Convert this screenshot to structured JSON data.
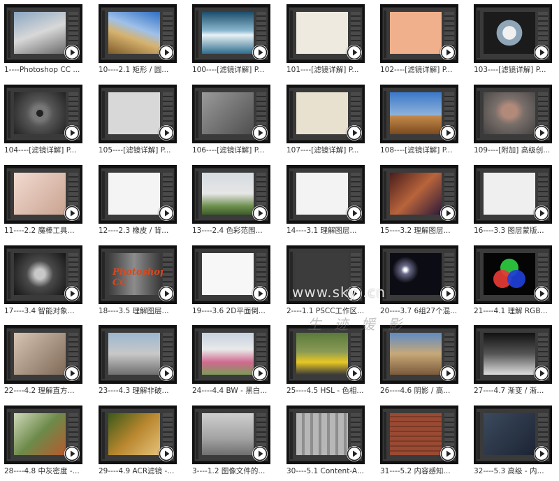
{
  "videos": [
    {
      "caption": "1----Photoshop CC ...",
      "visual": "v0"
    },
    {
      "caption": "10----2.1 矩形 / 圆...",
      "visual": "v1"
    },
    {
      "caption": "100----[滤镜详解] P...",
      "visual": "v2"
    },
    {
      "caption": "101----[滤镜详解] P...",
      "visual": "v3"
    },
    {
      "caption": "102----[滤镜详解] P...",
      "visual": "v4"
    },
    {
      "caption": "103----[滤镜详解] P...",
      "visual": "v5"
    },
    {
      "caption": "104----[滤镜详解] P...",
      "visual": "v6"
    },
    {
      "caption": "105----[滤镜详解] P...",
      "visual": "v7"
    },
    {
      "caption": "106----[滤镜详解] P...",
      "visual": "v8"
    },
    {
      "caption": "107----[滤镜详解] P...",
      "visual": "v9"
    },
    {
      "caption": "108----[滤镜详解] P...",
      "visual": "v10"
    },
    {
      "caption": "109----[附加] 高级创...",
      "visual": "v11"
    },
    {
      "caption": "11----2.2 魔棒工具...",
      "visual": "v12"
    },
    {
      "caption": "12----2.3 橡皮 / 背...",
      "visual": "v13"
    },
    {
      "caption": "13----2.4 色彩范围...",
      "visual": "v14"
    },
    {
      "caption": "14----3.1 理解图层...",
      "visual": "v15"
    },
    {
      "caption": "15----3.2 理解图层...",
      "visual": "v16"
    },
    {
      "caption": "16----3.3 图层蒙版...",
      "visual": "v17"
    },
    {
      "caption": "17----3.4 智能对象...",
      "visual": "v18"
    },
    {
      "caption": "18----3.5 理解图层...",
      "visual": "v19",
      "logo": "Photoshop CC"
    },
    {
      "caption": "19----3.6 2D平面倒...",
      "visual": "v20"
    },
    {
      "caption": "2----1.1 PSCC工作区...",
      "visual": "v21"
    },
    {
      "caption": "20----3.7 6组27个混...",
      "visual": "v22"
    },
    {
      "caption": "21----4.1 理解 RGB...",
      "visual": "v23"
    },
    {
      "caption": "22----4.2 理解直方...",
      "visual": "v24"
    },
    {
      "caption": "23----4.3 理解非破...",
      "visual": "v25"
    },
    {
      "caption": "24----4.4 BW - 黑白...",
      "visual": "v26"
    },
    {
      "caption": "25----4.5 HSL - 色相...",
      "visual": "v27"
    },
    {
      "caption": "26----4.6 阴影 / 高...",
      "visual": "v28"
    },
    {
      "caption": "27----4.7 渐变 / 渐...",
      "visual": "v29"
    },
    {
      "caption": "28----4.8 中灰密度 -...",
      "visual": "v30"
    },
    {
      "caption": "29----4.9 ACR滤镜 -...",
      "visual": "v31"
    },
    {
      "caption": "3----1.2 图像文件的...",
      "visual": "v32"
    },
    {
      "caption": "30----5.1 Content-A...",
      "visual": "v33"
    },
    {
      "caption": "31----5.2 内容感知...",
      "visual": "v34"
    },
    {
      "caption": "32----5.3 高级 - 内...",
      "visual": "v35"
    }
  ],
  "watermark": {
    "site": "www.sky    .cn",
    "script": "生 迹 媛 影"
  },
  "colors": {
    "thumb_bg": "#111111",
    "caption_text": "#333333",
    "play_button": "#ffffff"
  },
  "icons": {
    "play": "play-icon"
  }
}
